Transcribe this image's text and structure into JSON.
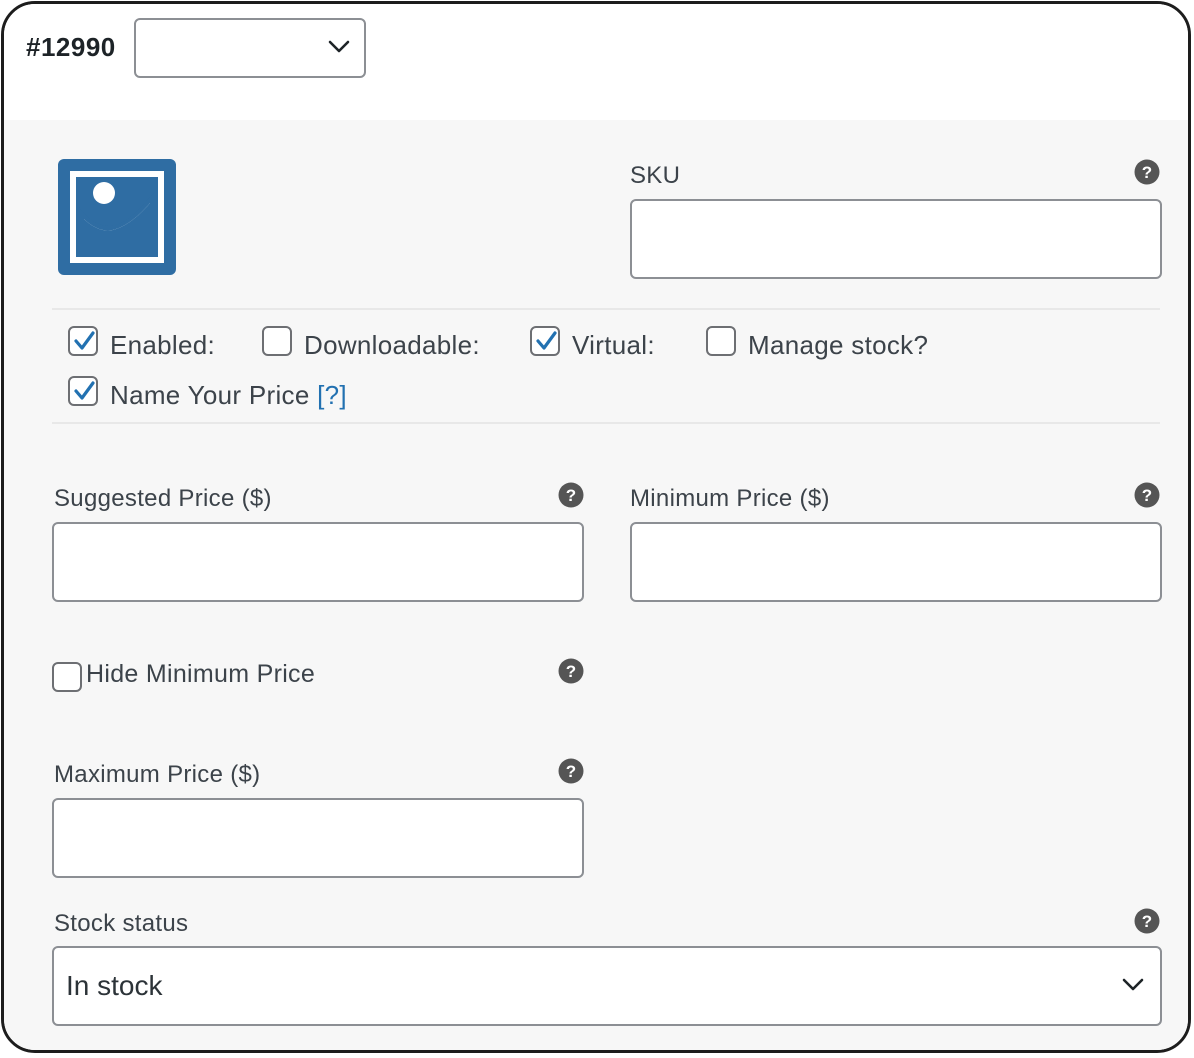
{
  "variation": {
    "id_label": "#12990",
    "attribute_select_value": ""
  },
  "image": {
    "icon": "image-placeholder-icon",
    "accent": "#2f6da3"
  },
  "sku": {
    "label": "SKU",
    "value": ""
  },
  "options": {
    "enabled": {
      "label": "Enabled:",
      "checked": true
    },
    "downloadable": {
      "label": "Downloadable:",
      "checked": false
    },
    "virtual": {
      "label": "Virtual:",
      "checked": true
    },
    "manage_stock": {
      "label": "Manage stock?",
      "checked": false
    },
    "name_your_price": {
      "label": "Name Your Price",
      "tip": "[?]",
      "checked": true
    }
  },
  "suggested_price": {
    "label": "Suggested Price ($)",
    "value": ""
  },
  "minimum_price": {
    "label": "Minimum Price ($)",
    "value": ""
  },
  "hide_minimum_price": {
    "label": "Hide Minimum Price",
    "checked": false
  },
  "maximum_price": {
    "label": "Maximum Price ($)",
    "value": ""
  },
  "stock_status": {
    "label": "Stock status",
    "value": "In stock"
  },
  "colors": {
    "check": "#2271b1",
    "help_icon": "#555555",
    "link": "#2271b1"
  }
}
